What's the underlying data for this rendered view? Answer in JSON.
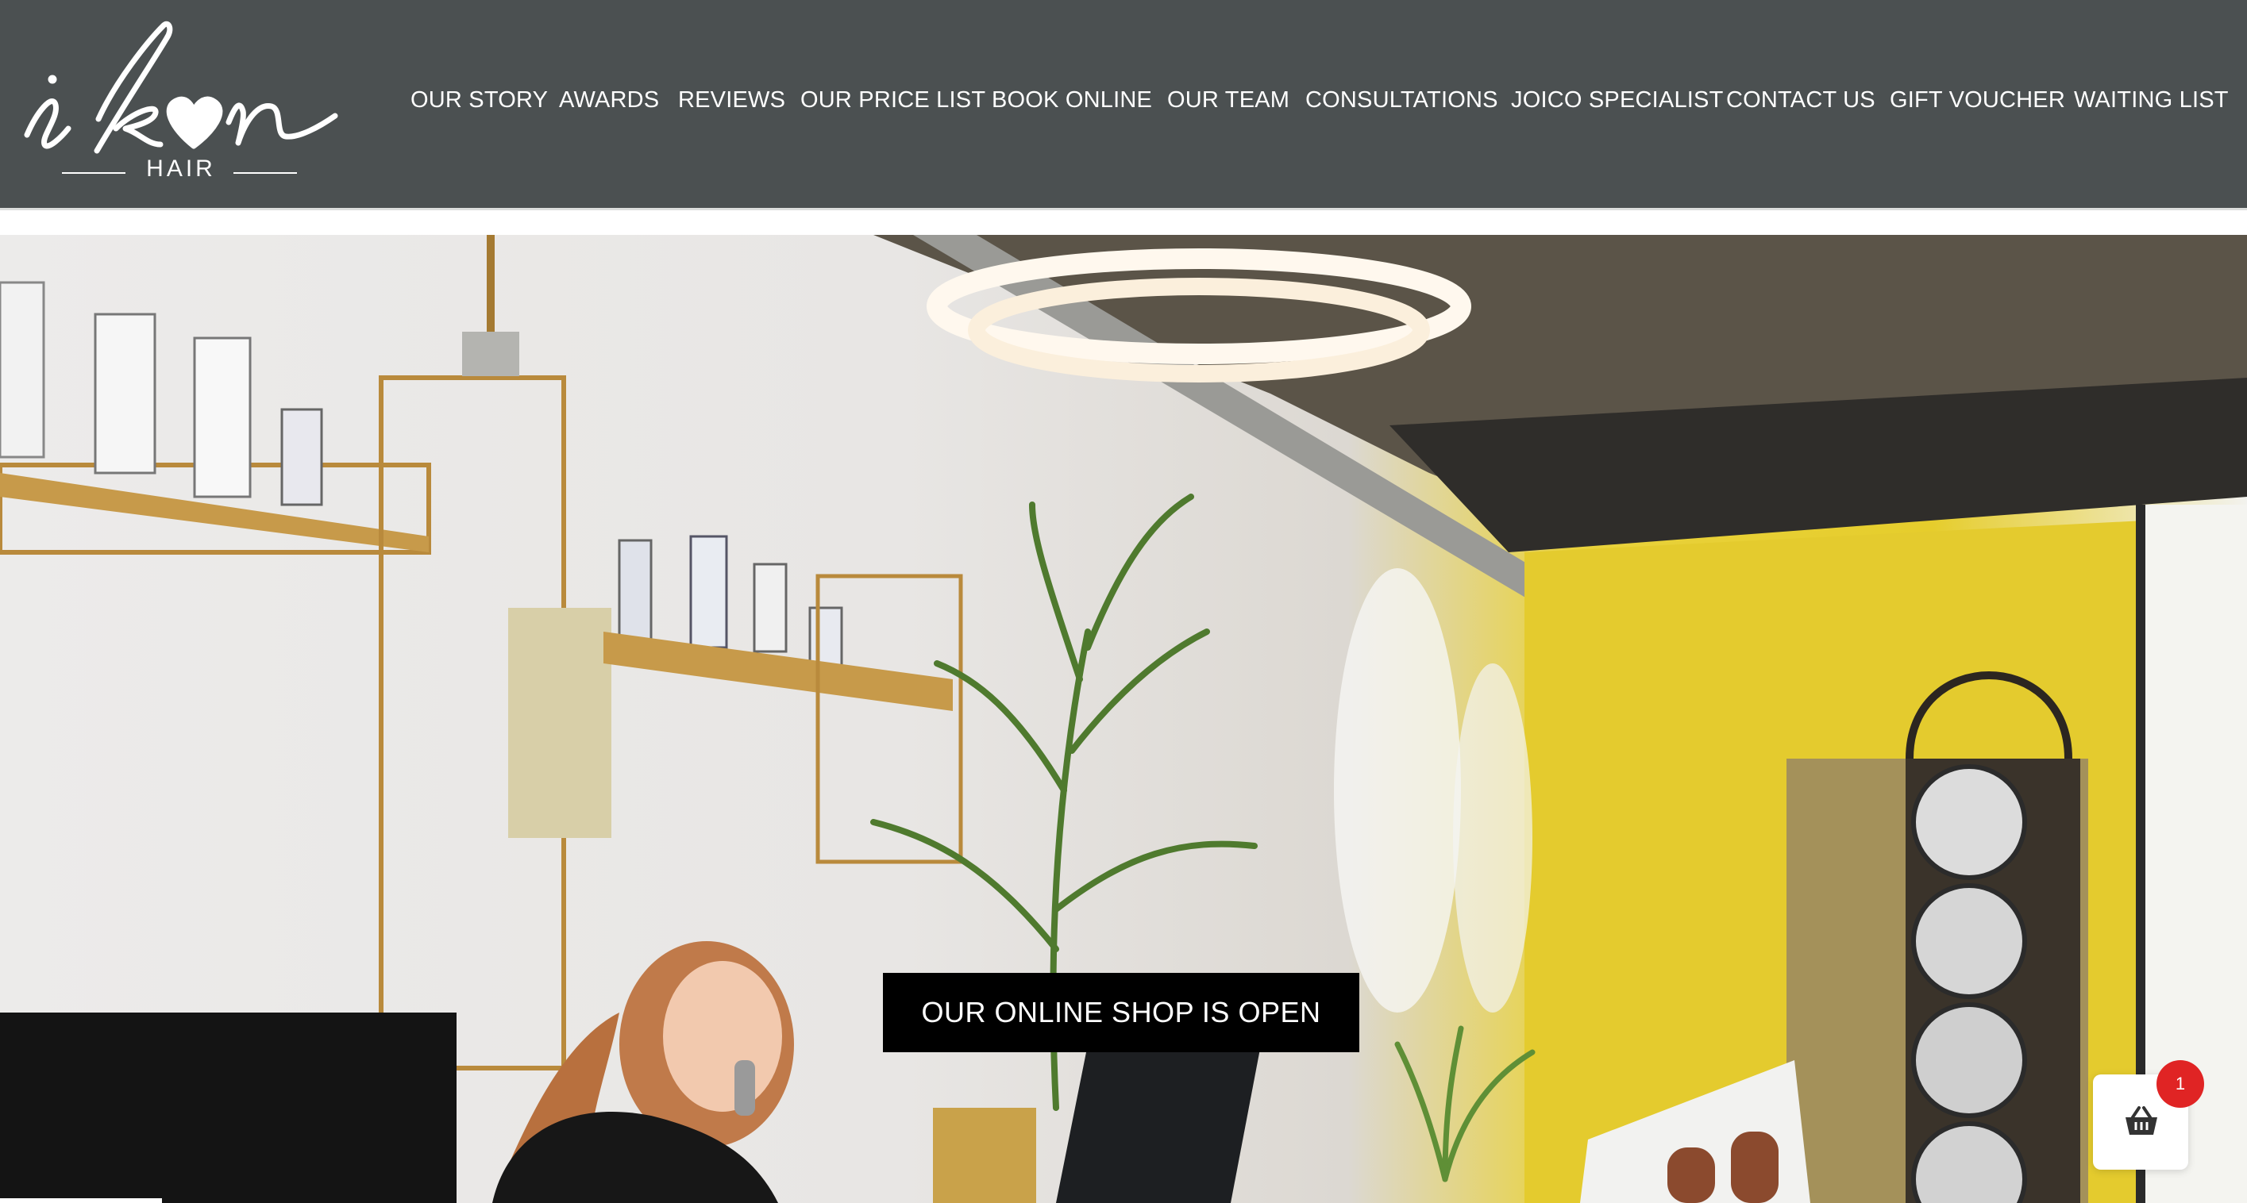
{
  "brand": {
    "logo_script": "ikon",
    "logo_sub": "HAIR"
  },
  "nav": {
    "items": [
      {
        "label": "OUR STORY"
      },
      {
        "label": "AWARDS"
      },
      {
        "label": "REVIEWS"
      },
      {
        "label": "OUR PRICE LIST"
      },
      {
        "label": "BOOK ONLINE"
      },
      {
        "label": "OUR TEAM"
      },
      {
        "label": "CONSULTATIONS"
      },
      {
        "label": "JOICO SPECIALIST"
      },
      {
        "label": "CONTACT US"
      },
      {
        "label": "GIFT VOUCHER"
      },
      {
        "label": "WAITING LIST"
      }
    ]
  },
  "hero": {
    "cta_label": "OUR ONLINE SHOP IS OPEN"
  },
  "cart": {
    "count": "1"
  },
  "colors": {
    "header_bg": "#4b5051",
    "cta_bg": "#000000",
    "badge": "#e02424",
    "accent_wall": "#e6cd2c"
  }
}
